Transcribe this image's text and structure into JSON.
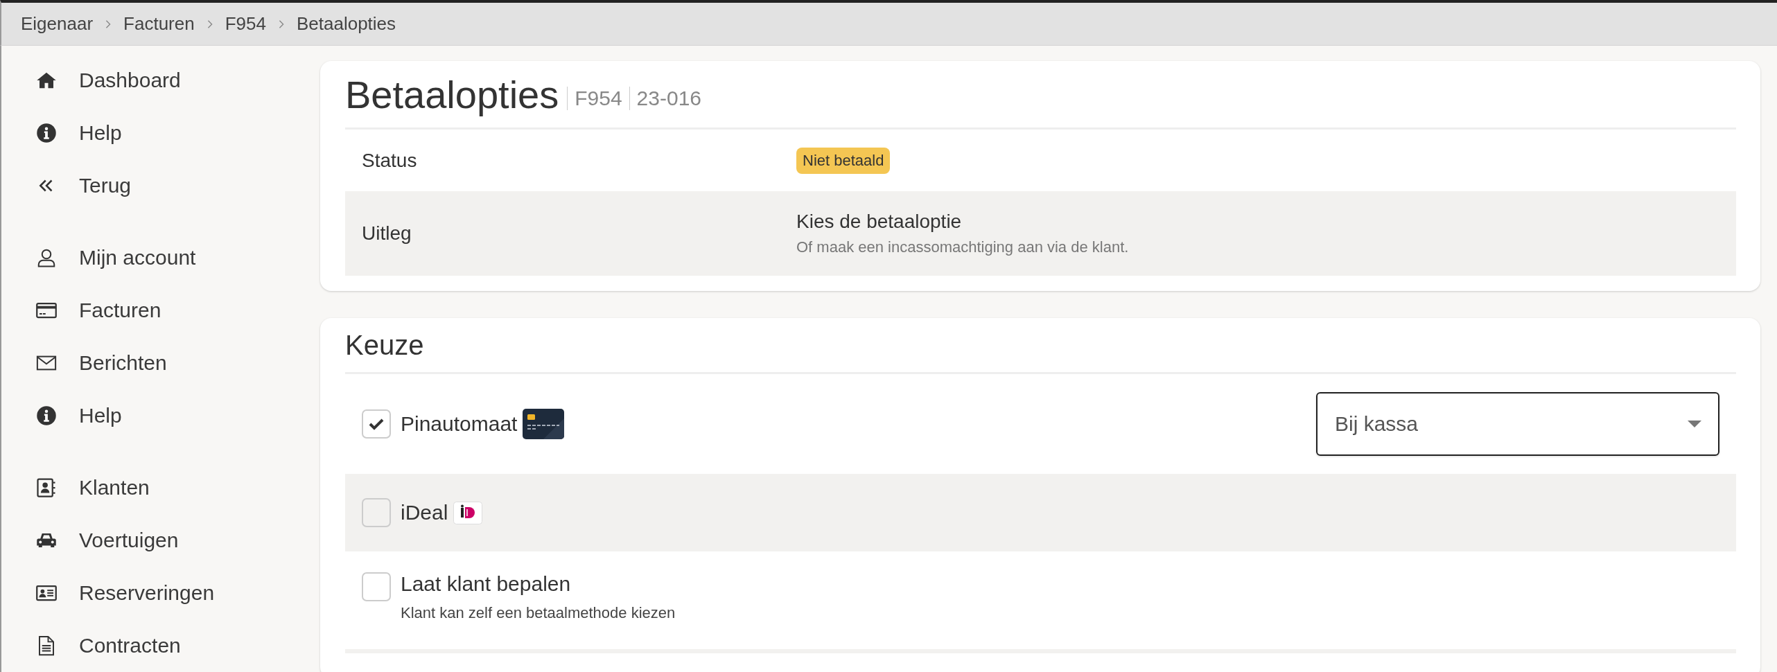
{
  "breadcrumb": [
    {
      "label": "Eigenaar"
    },
    {
      "label": "Facturen"
    },
    {
      "label": "F954"
    },
    {
      "label": "Betaalopties"
    }
  ],
  "sidebar": {
    "groups": [
      [
        {
          "kind": "home",
          "label": "Dashboard"
        },
        {
          "kind": "info",
          "label": "Help"
        },
        {
          "kind": "back",
          "label": "Terug"
        }
      ],
      [
        {
          "kind": "user",
          "label": "Mijn account"
        },
        {
          "kind": "card",
          "label": "Facturen"
        },
        {
          "kind": "mail",
          "label": "Berichten"
        },
        {
          "kind": "info",
          "label": "Help"
        }
      ],
      [
        {
          "kind": "contacts",
          "label": "Klanten"
        },
        {
          "kind": "car",
          "label": "Voertuigen"
        },
        {
          "kind": "idcard",
          "label": "Reserveringen"
        },
        {
          "kind": "doc",
          "label": "Contracten"
        }
      ]
    ]
  },
  "header": {
    "title": "Betaalopties",
    "subtitles": [
      "F954",
      "23-016"
    ],
    "rows": [
      {
        "kind": "badge",
        "label": "Status",
        "value": "Niet betaald"
      },
      {
        "kind": "text",
        "label": "Uitleg",
        "value": "Kies de betaaloptie",
        "description": "Of maak een incassomachtiging aan via de klant."
      }
    ]
  },
  "choice": {
    "title": "Keuze",
    "options": [
      {
        "kind": "card",
        "label": "Pinautomaat",
        "checked": true,
        "select": {
          "value": "Bij kassa"
        }
      },
      {
        "kind": "ideal",
        "label": "iDeal",
        "checked": false
      },
      {
        "kind": "plain",
        "label": "Laat klant bepalen",
        "checked": false,
        "description": "Klant kan zelf een betaalmethode kiezen"
      }
    ]
  }
}
